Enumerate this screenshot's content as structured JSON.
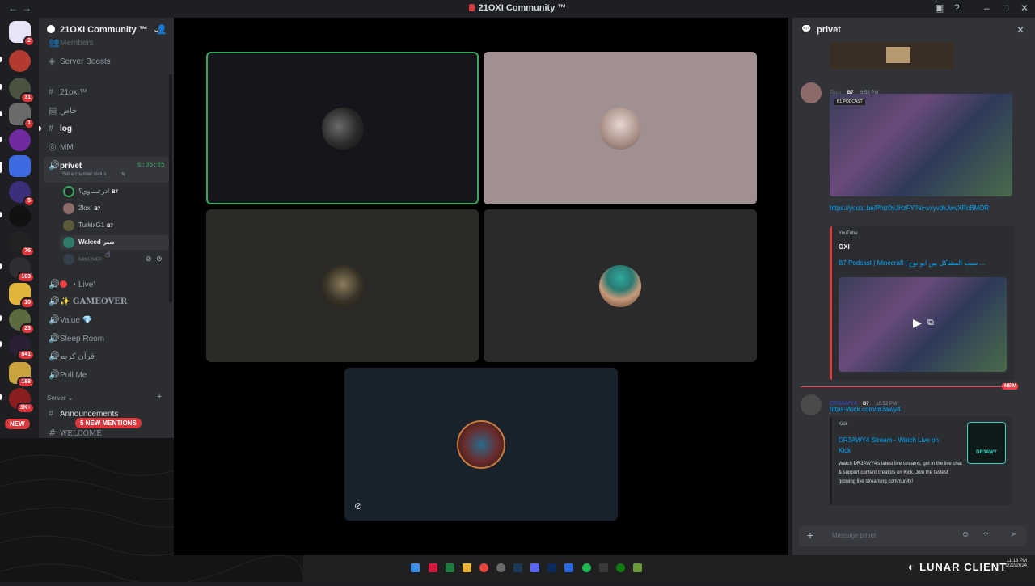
{
  "window": {
    "title": "21OXI Community ™",
    "nav_back": "←",
    "nav_forward": "→",
    "icons": [
      "inbox-icon",
      "help-icon",
      "minimize-icon",
      "maximize-icon",
      "close-icon"
    ]
  },
  "server": {
    "name": "21OXI Community ™",
    "chevron": "⌄"
  },
  "rail": {
    "badges": [
      "2",
      "31",
      "1",
      "5",
      "76",
      "103",
      "10",
      "23",
      "841",
      "188",
      "1K+"
    ],
    "new_label": "NEW"
  },
  "sidebar": {
    "top_faded": "Members",
    "server_boosts": "Server Boosts",
    "channels": [
      {
        "name": "21oxi™",
        "type": "text"
      },
      {
        "name": "خاص",
        "type": "forum"
      },
      {
        "name": "log",
        "type": "text"
      },
      {
        "name": "MM",
        "type": "stage"
      }
    ],
    "voice_active": {
      "name": "privet",
      "timer": "6:35:05",
      "status_placeholder": "Set a channel status",
      "users": [
        {
          "name": "درعـــاوي؟!",
          "tag": "B7"
        },
        {
          "name": "2loxi",
          "tag": "B7"
        },
        {
          "name": "TurkixG1",
          "tag": "B7"
        },
        {
          "name": "Waleed",
          "tag": "شمر"
        },
        {
          "name": "GAMEOVER",
          "tag": ""
        }
      ]
    },
    "voice_channels": [
      "・Live'",
      "✨ GAMEOVER",
      "Value 💎",
      "Sleep Room",
      "قرآن كريم",
      "Pull Me"
    ],
    "category": "Server",
    "text_channels": [
      "Announcements",
      "WELCOME"
    ],
    "mentions_pill": "5 NEW MENTIONS"
  },
  "stage": {
    "tiles": [
      {
        "label": "tile-1",
        "bg": "#15161b",
        "speaking": true
      },
      {
        "label": "tile-2",
        "bg": "#a09091",
        "speaking": false
      },
      {
        "label": "tile-3",
        "bg": "#2b2a26",
        "speaking": false
      },
      {
        "label": "tile-4",
        "bg": "#2a2a2a",
        "speaking": false
      },
      {
        "label": "tile-5",
        "bg": "#17222c",
        "speaking": false
      }
    ],
    "speaking_color": "#3ba55d"
  },
  "chat": {
    "channel": "privet",
    "messages": [
      {
        "author": "2loxi",
        "tag": "B7",
        "time": "9:58 PM",
        "thumb_text_1": "B1 PODCAST",
        "link": "https://youtu.be/Phiz0yJHzFY?si=vxyvdkJwvXRcBMOR",
        "embed_provider": "YouTube",
        "embed_author": "OXI",
        "embed_title": "B7 Podcast | Minecraft | سبب المشاكل بين ابو نوح ...",
        "embed_color": "#d83c3e"
      },
      {
        "author": "DR3AWY4",
        "tag": "B7",
        "time": "10:52 PM",
        "link": "https://kick.com/dr3awy4",
        "embed_provider": "Kick",
        "embed_title": "DR3AWY4 Stream - Watch Live on Kick",
        "embed_desc": "Watch DR3AWY4's latest live streams, get in the live chat & support content creators on Kick. Join the fastest growing live streaming community!",
        "embed_thumb_text": "DR3AWY"
      }
    ],
    "new_divider": "NEW",
    "input_placeholder": "Message privet"
  },
  "taskbar": {
    "clock": "11:13 PM",
    "date": "1/22/2024",
    "brand": "LUNAR CLIENT"
  }
}
